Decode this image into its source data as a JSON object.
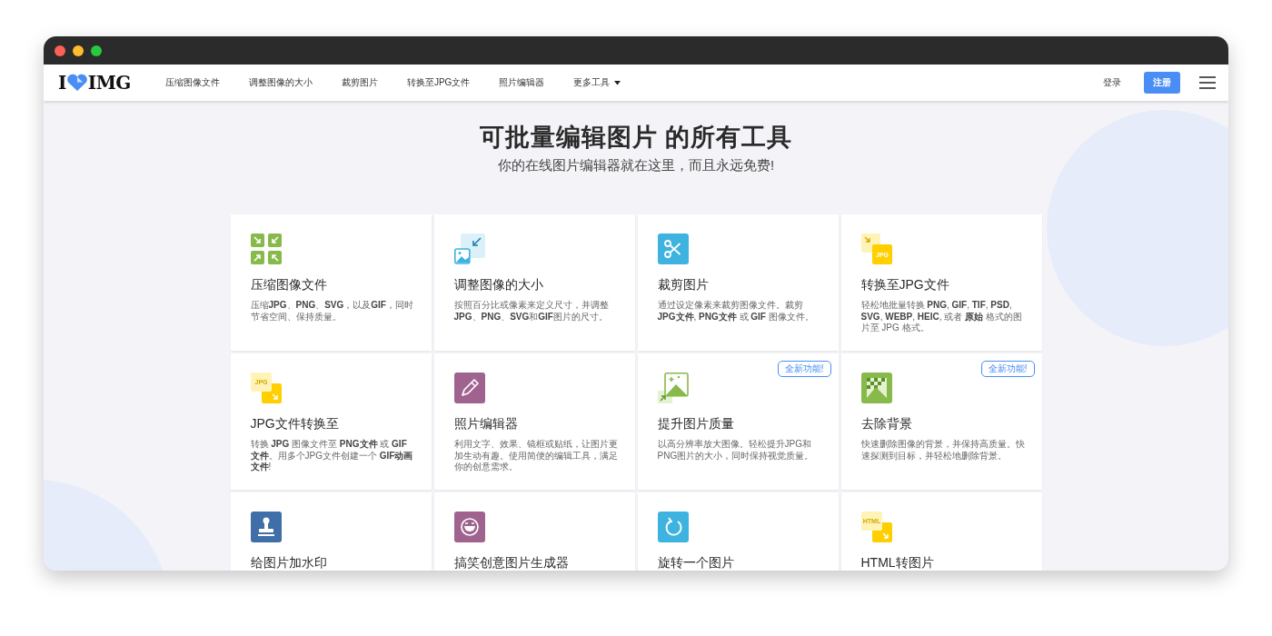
{
  "window": {
    "controls": [
      {
        "kind": "close"
      },
      {
        "kind": "minimize"
      },
      {
        "kind": "zoom"
      }
    ]
  },
  "nav": {
    "logo": {
      "left": "I",
      "right": "IMG"
    },
    "items": [
      {
        "label": "压缩图像文件",
        "kind": "link"
      },
      {
        "label": "调整图像的大小",
        "kind": "link"
      },
      {
        "label": "裁剪图片",
        "kind": "link"
      },
      {
        "label": "转换至JPG文件",
        "kind": "link"
      },
      {
        "label": "照片编辑器",
        "kind": "link"
      },
      {
        "label": "更多工具",
        "kind": "dropdown"
      }
    ],
    "login": "登录",
    "register": "注册"
  },
  "hero": {
    "title": "可批量编辑图片 的所有工具",
    "subtitle": "你的在线图片编辑器就在这里，而且永远免费!"
  },
  "tools": [
    {
      "kind": "compress",
      "title": "压缩图像文件",
      "description": "压缩**JPG**、**PNG**、**SVG**，以及**GIF**，同时节省空间、保持质量。"
    },
    {
      "kind": "resize",
      "title": "调整图像的大小",
      "description": "按照百分比或像素来定义尺寸，并调整**JPG**、**PNG**、**SVG**和**GIF**图片的尺寸。"
    },
    {
      "kind": "crop",
      "title": "裁剪图片",
      "description": "通过设定像素来裁剪图像文件。裁剪 **JPG文件**, **PNG文件** 或 **GIF** 图像文件。"
    },
    {
      "kind": "to_format",
      "icon_label": "JPG",
      "title": "转换至JPG文件",
      "description": "轻松地批量转换 **PNG**, **GIF**, **TIF**, **PSD**, **SVG**, **WEBP**, **HEIC**, 或者 **原始** 格式的图片至 JPG 格式。"
    },
    {
      "kind": "from_format",
      "icon_label": "JPG",
      "title": "JPG文件转换至",
      "description": "转换 **JPG** 图像文件至 **PNG文件** 或 **GIF文件**。用多个JPG文件创建一个 **GIF动画文件**!"
    },
    {
      "kind": "editor",
      "title": "照片编辑器",
      "description": "利用文字、效果、镜框或贴纸，让图片更加生动有趣。使用简便的编辑工具，满足你的创意需求。"
    },
    {
      "kind": "upscale",
      "title": "提升图片质量",
      "description": "以高分辨率放大图像。轻松提升JPG和PNG图片的大小，同时保持视觉质量。",
      "badge": "全新功能!"
    },
    {
      "kind": "remove_bg",
      "title": "去除背景",
      "description": "快速删除图像的背景，并保持高质量。快速探测到目标，并轻松地删除背景。",
      "badge": "全新功能!"
    },
    {
      "kind": "watermark",
      "title": "给图片加水印"
    },
    {
      "kind": "meme",
      "title": "搞笑创意图片生成器"
    },
    {
      "kind": "rotate",
      "title": "旋转一个图片"
    },
    {
      "kind": "from_format",
      "icon_label": "HTML",
      "title": "HTML转图片"
    }
  ]
}
